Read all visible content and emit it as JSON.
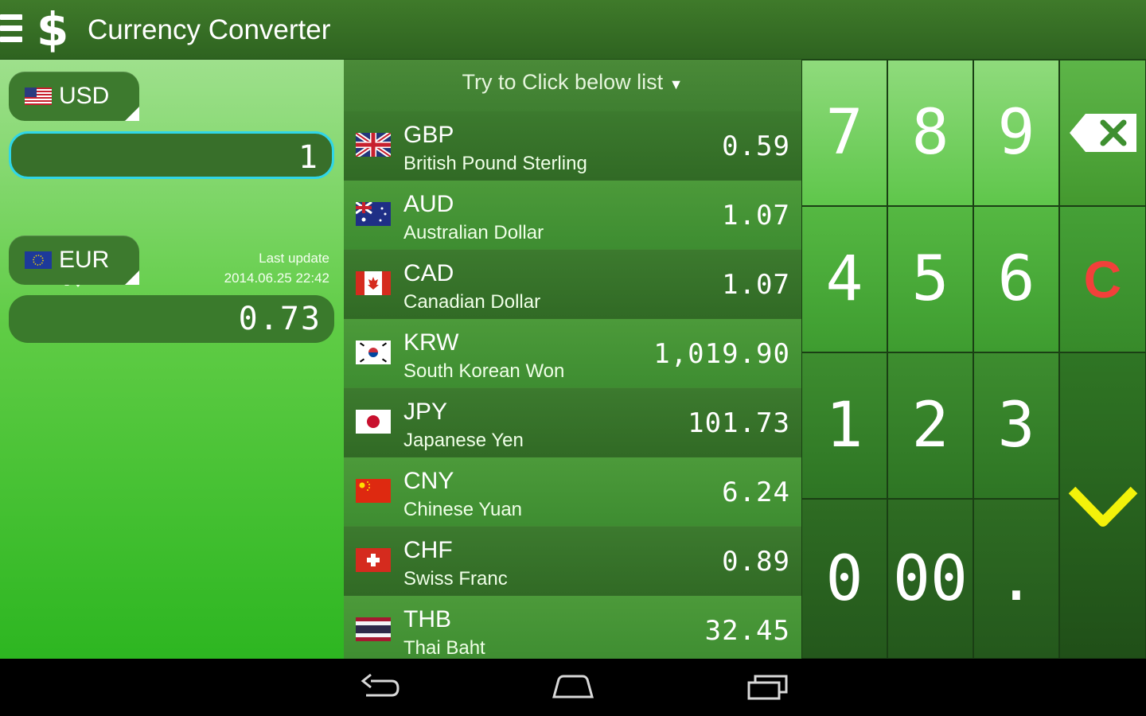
{
  "app": {
    "title": "Currency Converter",
    "logo": "$"
  },
  "left": {
    "from": {
      "code": "USD",
      "flag_icon": "us-flag-icon",
      "amount": "1"
    },
    "to": {
      "code": "EUR",
      "flag_icon": "eu-flag-icon",
      "amount": "0.73"
    },
    "last_update_label": "Last update",
    "last_update_time": "2014.06.25 22:42"
  },
  "list": {
    "header": "Try to Click below list",
    "rows": [
      {
        "code": "GBP",
        "name": "British Pound Sterling",
        "rate": "0.59",
        "flag_icon": "gb-flag-icon"
      },
      {
        "code": "AUD",
        "name": "Australian Dollar",
        "rate": "1.07",
        "flag_icon": "au-flag-icon"
      },
      {
        "code": "CAD",
        "name": "Canadian Dollar",
        "rate": "1.07",
        "flag_icon": "ca-flag-icon"
      },
      {
        "code": "KRW",
        "name": "South Korean Won",
        "rate": "1,019.90",
        "flag_icon": "kr-flag-icon"
      },
      {
        "code": "JPY",
        "name": "Japanese Yen",
        "rate": "101.73",
        "flag_icon": "jp-flag-icon"
      },
      {
        "code": "CNY",
        "name": "Chinese Yuan",
        "rate": "6.24",
        "flag_icon": "cn-flag-icon"
      },
      {
        "code": "CHF",
        "name": "Swiss Franc",
        "rate": "0.89",
        "flag_icon": "ch-flag-icon"
      },
      {
        "code": "THB",
        "name": "Thai Baht",
        "rate": "32.45",
        "flag_icon": "th-flag-icon"
      }
    ]
  },
  "keypad": {
    "keys": [
      "7",
      "8",
      "9",
      "4",
      "5",
      "6",
      "1",
      "2",
      "3",
      "0",
      "00",
      "."
    ],
    "clear": "C",
    "backspace_icon": "backspace-icon",
    "confirm_icon": "checkmark-icon"
  },
  "colors": {
    "accent_cyan": "#2fd6e8",
    "clear_red": "#f2403a",
    "confirm_yellow": "#f3f20a"
  }
}
